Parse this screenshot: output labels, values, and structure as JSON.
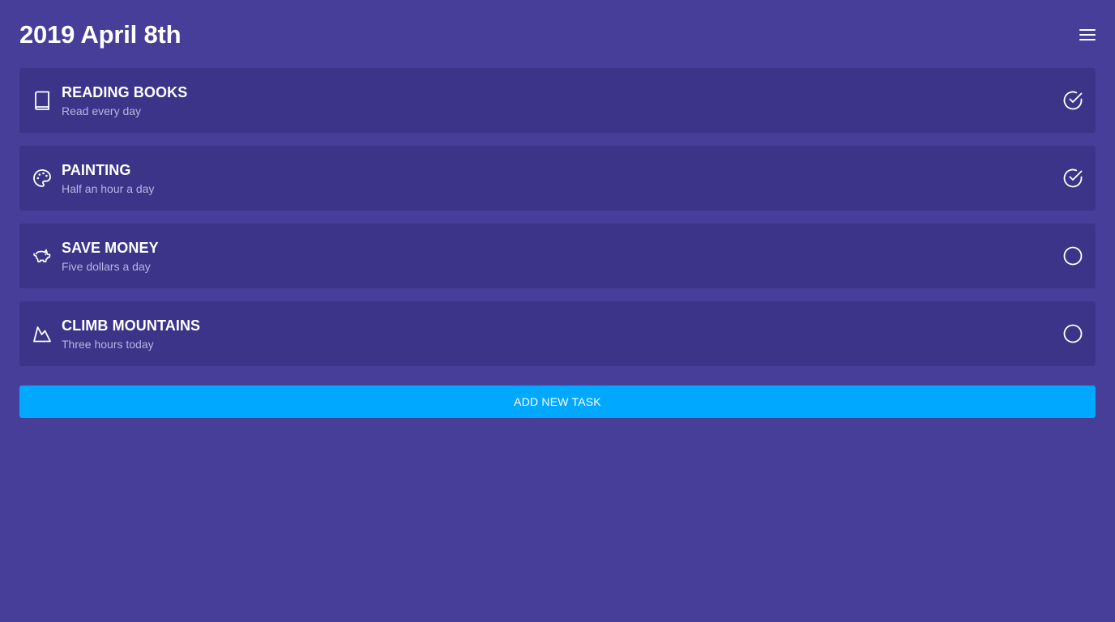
{
  "header": {
    "title": "2019 April 8th",
    "menu_icon": "hamburger-menu-icon"
  },
  "tasks": [
    {
      "title": "READING BOOKS",
      "subtitle": "Read every day",
      "icon": "book-icon",
      "completed": true
    },
    {
      "title": "PAINTING",
      "subtitle": "Half an hour a day",
      "icon": "palette-icon",
      "completed": true
    },
    {
      "title": "SAVE MONEY",
      "subtitle": "Five dollars a day",
      "icon": "piggy-bank-icon",
      "completed": false
    },
    {
      "title": "CLIMB MOUNTAINS",
      "subtitle": "Three hours today",
      "icon": "mountain-icon",
      "completed": false
    }
  ],
  "add_button": {
    "label": "ADD NEW TASK"
  },
  "colors": {
    "background": "#473e99",
    "card": "#3c3489",
    "accent": "#00a8ff",
    "subtitle": "#b9b4e0"
  }
}
